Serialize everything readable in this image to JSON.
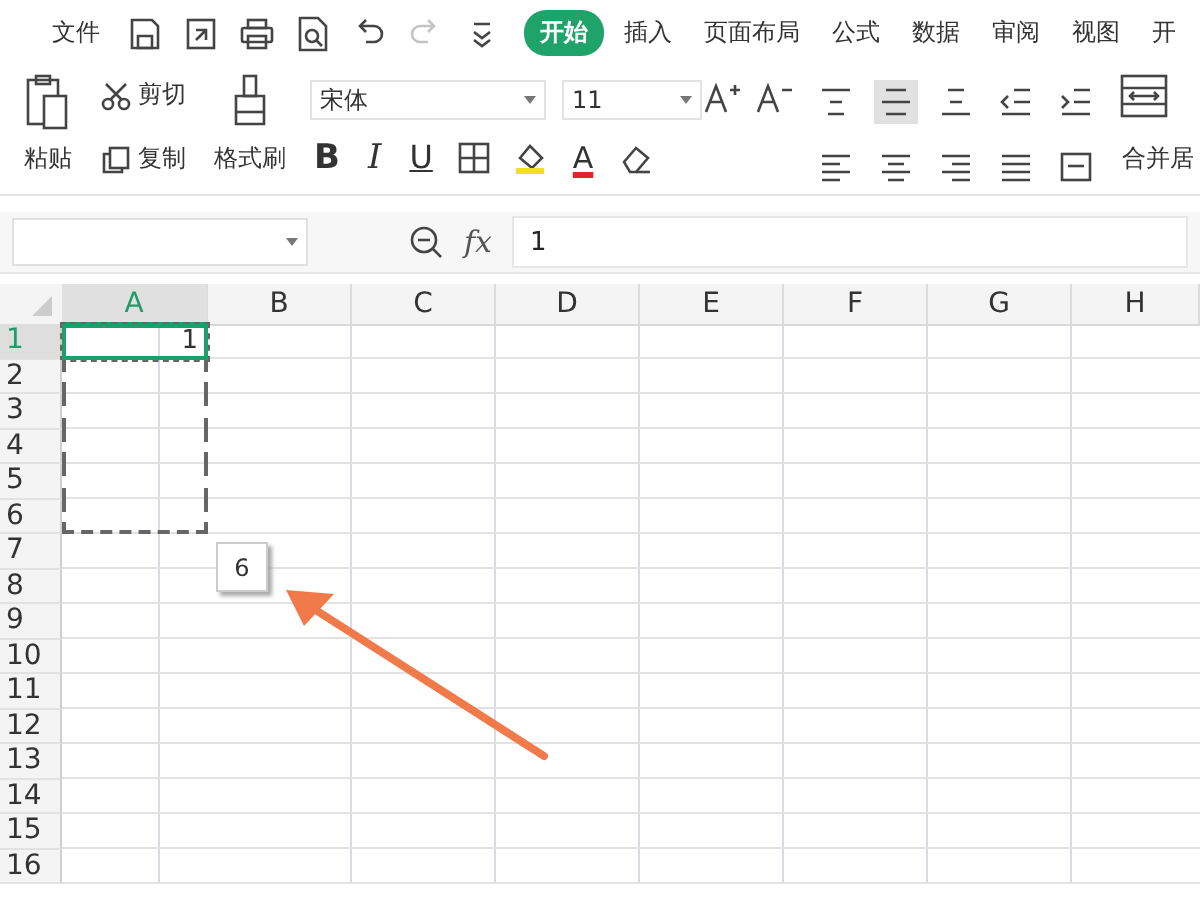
{
  "menu": {
    "file_label": "文件",
    "quick_access": [
      {
        "kind": "save",
        "disabled": false
      },
      {
        "kind": "export",
        "disabled": false
      },
      {
        "kind": "print",
        "disabled": false
      },
      {
        "kind": "preview",
        "disabled": false
      },
      {
        "kind": "undo",
        "disabled": false
      },
      {
        "kind": "redo",
        "disabled": true
      },
      {
        "kind": "more",
        "disabled": false
      }
    ],
    "tabs": [
      {
        "label": "开始",
        "selected": true
      },
      {
        "label": "插入",
        "selected": false
      },
      {
        "label": "页面布局",
        "selected": false
      },
      {
        "label": "公式",
        "selected": false
      },
      {
        "label": "数据",
        "selected": false
      },
      {
        "label": "审阅",
        "selected": false
      },
      {
        "label": "视图",
        "selected": false
      },
      {
        "label": "开",
        "selected": false
      }
    ]
  },
  "ribbon": {
    "paste": "粘贴",
    "cut": "剪切",
    "copy": "复制",
    "format_painter": "格式刷",
    "font_name": "宋体",
    "font_size": "11",
    "font_buttons": [
      {
        "kind": "bold",
        "label": "B"
      },
      {
        "kind": "italic",
        "label": "I"
      },
      {
        "kind": "underline",
        "label": "U"
      },
      {
        "kind": "border"
      },
      {
        "kind": "fill"
      },
      {
        "kind": "fontcolor",
        "label": "A"
      },
      {
        "kind": "eraser"
      }
    ],
    "align_top": [
      {
        "kind": "top",
        "selected": false
      },
      {
        "kind": "middle",
        "selected": true
      },
      {
        "kind": "bottom",
        "selected": false
      },
      {
        "kind": "outdent",
        "selected": false
      },
      {
        "kind": "indent",
        "selected": false
      }
    ],
    "align_bottom": [
      {
        "kind": "left",
        "selected": false
      },
      {
        "kind": "center",
        "selected": false
      },
      {
        "kind": "right",
        "selected": false
      },
      {
        "kind": "justify",
        "selected": false
      },
      {
        "kind": "distributed",
        "selected": false
      }
    ],
    "merge_label": "合并居"
  },
  "formula_bar": {
    "fx": "fx",
    "formula": "1"
  },
  "sheet": {
    "columns": [
      {
        "label": "A",
        "selected": true
      },
      {
        "label": "B",
        "selected": false
      },
      {
        "label": "C",
        "selected": false
      },
      {
        "label": "D",
        "selected": false
      },
      {
        "label": "E",
        "selected": false
      },
      {
        "label": "F",
        "selected": false
      },
      {
        "label": "G",
        "selected": false
      },
      {
        "label": "H",
        "selected": false
      }
    ],
    "rows": [
      {
        "label": "1",
        "selected": true,
        "active": true,
        "in_range": true,
        "column_a": "1"
      },
      {
        "label": "2",
        "selected": false,
        "active": false,
        "in_range": true
      },
      {
        "label": "3",
        "selected": false,
        "active": false,
        "in_range": true
      },
      {
        "label": "4",
        "selected": false,
        "active": false,
        "in_range": true
      },
      {
        "label": "5",
        "selected": false,
        "active": false,
        "in_range": true
      },
      {
        "label": "6",
        "selected": false,
        "active": false,
        "in_range": true
      },
      {
        "label": "7",
        "selected": false,
        "active": false,
        "in_range": false
      },
      {
        "label": "8",
        "selected": false,
        "active": false,
        "in_range": false
      },
      {
        "label": "9",
        "selected": false,
        "active": false,
        "in_range": false
      },
      {
        "label": "10",
        "selected": false,
        "active": false,
        "in_range": false
      },
      {
        "label": "11",
        "selected": false,
        "active": false,
        "in_range": false
      },
      {
        "label": "12",
        "selected": false,
        "active": false,
        "in_range": false
      },
      {
        "label": "13",
        "selected": false,
        "active": false,
        "in_range": false
      },
      {
        "label": "14",
        "selected": false,
        "active": false,
        "in_range": false
      },
      {
        "label": "15",
        "selected": false,
        "active": false,
        "in_range": false
      },
      {
        "label": "16",
        "selected": false,
        "active": false,
        "in_range": false
      }
    ],
    "fill_tooltip": "6"
  }
}
